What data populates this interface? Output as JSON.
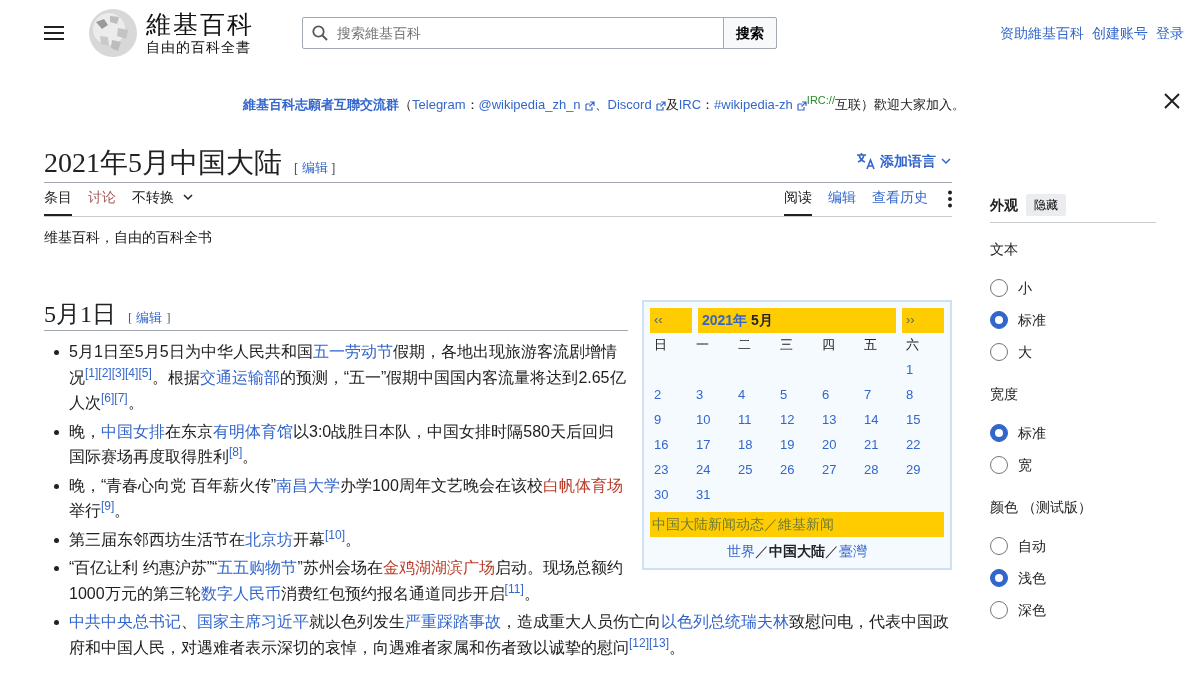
{
  "header": {
    "logo": {
      "name": "維基百科",
      "tagline": "自由的百科全書"
    },
    "search": {
      "placeholder": "搜索維基百科",
      "button": "搜索"
    },
    "user_links": [
      "资助維基百科",
      "创建账号",
      "登录"
    ]
  },
  "banner": {
    "parts": [
      {
        "kind": "strong-link",
        "text": "維基百科志願者互聯交流群"
      },
      {
        "kind": "plain",
        "text": "（"
      },
      {
        "kind": "link",
        "text": "Telegram"
      },
      {
        "kind": "plain",
        "text": "："
      },
      {
        "kind": "external",
        "text": "@wikipedia_zh_n"
      },
      {
        "kind": "plain",
        "text": "、"
      },
      {
        "kind": "external",
        "text": "Discord"
      },
      {
        "kind": "plain",
        "text": "及"
      },
      {
        "kind": "link",
        "text": "IRC"
      },
      {
        "kind": "plain",
        "text": "："
      },
      {
        "kind": "external",
        "text": "#wikipedia-zh"
      },
      {
        "kind": "note",
        "text": "IRC://"
      },
      {
        "kind": "plain",
        "text": "互联）歡迎大家加入。"
      }
    ]
  },
  "page": {
    "title": "2021年5月中国大陆",
    "edit": {
      "open": "[",
      "label": "编辑",
      "close": "]"
    },
    "language_button": "添加语言",
    "tabs_left": [
      {
        "label": "条目",
        "selected": true,
        "kind": "tab"
      },
      {
        "label": "讨论",
        "selected": false,
        "kind": "missing"
      },
      {
        "label": "不转换",
        "selected": false,
        "kind": "dropdown"
      }
    ],
    "tabs_right": [
      {
        "label": "阅读",
        "selected": true
      },
      {
        "label": "编辑",
        "selected": false
      },
      {
        "label": "查看历史",
        "selected": false
      }
    ],
    "tagline": "维基百科，自由的百科全书",
    "section": {
      "heading": "5月1日",
      "edit": {
        "open": "[",
        "label": "编辑",
        "close": "]"
      }
    },
    "items": [
      {
        "parts": [
          {
            "kind": "plain",
            "text": "5月1日至5月5日为中华人民共和国"
          },
          {
            "kind": "link",
            "text": "五一劳动节"
          },
          {
            "kind": "plain",
            "text": "假期，各地出现旅游客流剧增情况"
          },
          {
            "kind": "ref",
            "text": "[1]"
          },
          {
            "kind": "ref",
            "text": "[2]"
          },
          {
            "kind": "ref",
            "text": "[3]"
          },
          {
            "kind": "ref",
            "text": "[4]"
          },
          {
            "kind": "ref",
            "text": "[5]"
          },
          {
            "kind": "plain",
            "text": "。根据"
          },
          {
            "kind": "link",
            "text": "交通运输部"
          },
          {
            "kind": "plain",
            "text": "的预测，“五一”假期中国国内客流量将达到2.65亿人次"
          },
          {
            "kind": "ref",
            "text": "[6]"
          },
          {
            "kind": "ref",
            "text": "[7]"
          },
          {
            "kind": "plain",
            "text": "。"
          }
        ]
      },
      {
        "parts": [
          {
            "kind": "plain",
            "text": "晚，"
          },
          {
            "kind": "link",
            "text": "中国女排"
          },
          {
            "kind": "plain",
            "text": "在东京"
          },
          {
            "kind": "link",
            "text": "有明体育馆"
          },
          {
            "kind": "plain",
            "text": "以3:0战胜日本队，中国女排时隔580天后回归国际赛场再度取得胜利"
          },
          {
            "kind": "ref",
            "text": "[8]"
          },
          {
            "kind": "plain",
            "text": "。"
          }
        ]
      },
      {
        "parts": [
          {
            "kind": "plain",
            "text": "晚，“青春心向党 百年薪火传”"
          },
          {
            "kind": "link",
            "text": "南昌大学"
          },
          {
            "kind": "plain",
            "text": "办学100周年文艺晚会在该校"
          },
          {
            "kind": "missing",
            "text": "白帆体育场"
          },
          {
            "kind": "plain",
            "text": "举行"
          },
          {
            "kind": "ref",
            "text": "[9]"
          },
          {
            "kind": "plain",
            "text": "。"
          }
        ]
      },
      {
        "parts": [
          {
            "kind": "plain",
            "text": "第三届东邻西坊生活节在"
          },
          {
            "kind": "link",
            "text": "北京坊"
          },
          {
            "kind": "plain",
            "text": "开幕"
          },
          {
            "kind": "ref",
            "text": "[10]"
          },
          {
            "kind": "plain",
            "text": "。"
          }
        ]
      },
      {
        "parts": [
          {
            "kind": "plain",
            "text": "“百亿让利 约惠沪苏”“"
          },
          {
            "kind": "link",
            "text": "五五购物节"
          },
          {
            "kind": "plain",
            "text": "”苏州会场在"
          },
          {
            "kind": "missing",
            "text": "金鸡湖湖滨广场"
          },
          {
            "kind": "plain",
            "text": "启动。现场总额约1000万元的第三轮"
          },
          {
            "kind": "link",
            "text": "数字人民币"
          },
          {
            "kind": "plain",
            "text": "消费红包预约报名通道同步开启"
          },
          {
            "kind": "ref",
            "text": "[11]"
          },
          {
            "kind": "plain",
            "text": "。"
          }
        ]
      },
      {
        "parts": [
          {
            "kind": "link",
            "text": "中共中央总书记"
          },
          {
            "kind": "plain",
            "text": "、"
          },
          {
            "kind": "link",
            "text": "国家主席习近平"
          },
          {
            "kind": "plain",
            "text": "就以色列发生"
          },
          {
            "kind": "link",
            "text": "严重踩踏事故"
          },
          {
            "kind": "plain",
            "text": "，造成重大人员伤亡向"
          },
          {
            "kind": "link",
            "text": "以色列总统瑞夫林"
          },
          {
            "kind": "plain",
            "text": "致慰问电，代表中国政府和中国人民，对遇难者表示深切的哀悼，向遇难者家属和伤者致以诚挚的慰问"
          },
          {
            "kind": "ref",
            "text": "[12]"
          },
          {
            "kind": "ref",
            "text": "[13]"
          },
          {
            "kind": "plain",
            "text": "。"
          }
        ]
      }
    ],
    "calendar": {
      "prev": "‹‹",
      "year": "2021年",
      "month": "5月",
      "next": "››",
      "weekdays": [
        "日",
        "一",
        "二",
        "三",
        "四",
        "五",
        "六"
      ],
      "weeks": [
        {
          "kind": "end",
          "days": [
            "1"
          ]
        },
        {
          "kind": "full",
          "days": [
            "2",
            "3",
            "4",
            "5",
            "6",
            "7",
            "8"
          ]
        },
        {
          "kind": "full",
          "days": [
            "9",
            "10",
            "11",
            "12",
            "13",
            "14",
            "15"
          ]
        },
        {
          "kind": "full",
          "days": [
            "16",
            "17",
            "18",
            "19",
            "20",
            "21",
            "22"
          ]
        },
        {
          "kind": "full",
          "days": [
            "23",
            "24",
            "25",
            "26",
            "27",
            "28",
            "29"
          ]
        },
        {
          "kind": "start",
          "days": [
            "30",
            "31"
          ]
        }
      ],
      "news_links": [
        "中国大陆新闻动态",
        "／",
        "維基新闻"
      ],
      "regions": [
        {
          "text": "世界",
          "kind": "link",
          "selected": false
        },
        {
          "text": "／",
          "kind": "sep"
        },
        {
          "text": "中国大陆",
          "kind": "link",
          "selected": true
        },
        {
          "text": "／",
          "kind": "sep"
        },
        {
          "text": "臺灣",
          "kind": "link",
          "selected": false
        }
      ]
    }
  },
  "sidebar": {
    "title": "外观",
    "hide_button": "隐藏",
    "groups": [
      {
        "label": "文本",
        "options": [
          {
            "label": "小",
            "selected": false
          },
          {
            "label": "标准",
            "selected": true
          },
          {
            "label": "大",
            "selected": false
          }
        ]
      },
      {
        "label": "宽度",
        "options": [
          {
            "label": "标准",
            "selected": true
          },
          {
            "label": "宽",
            "selected": false
          }
        ]
      },
      {
        "label": "颜色 （测试版）",
        "options": [
          {
            "label": "自动",
            "selected": false
          },
          {
            "label": "浅色",
            "selected": true
          },
          {
            "label": "深色",
            "selected": false
          }
        ]
      }
    ]
  }
}
